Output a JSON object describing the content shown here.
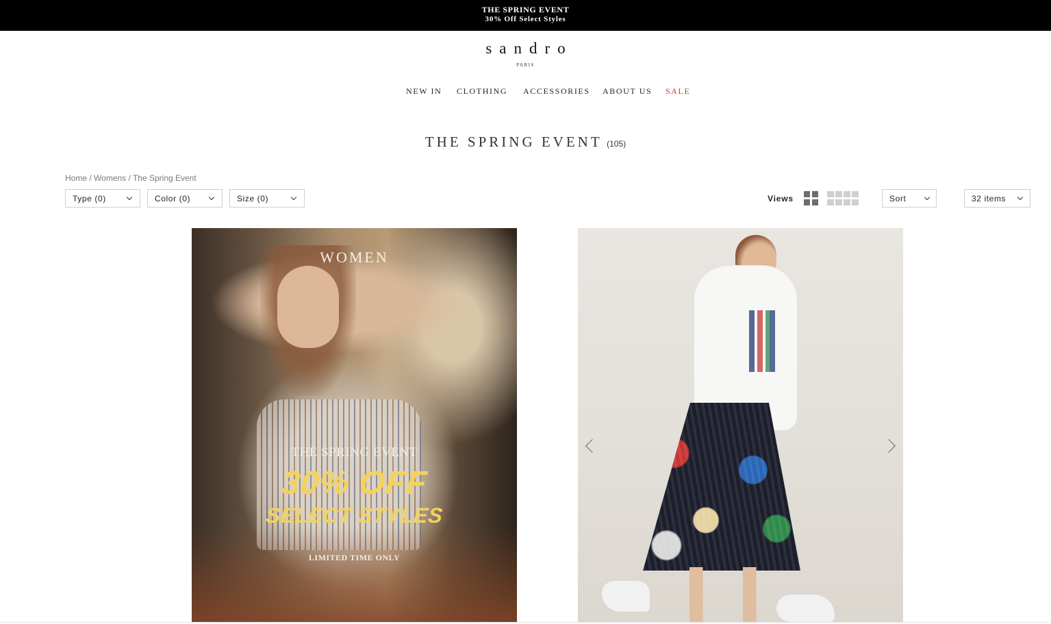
{
  "promo": {
    "title": "THE SPRING EVENT",
    "subtitle": "30% Off Select Styles"
  },
  "brand": {
    "logo": "sandro",
    "tagline": "PARIS"
  },
  "nav": {
    "items": [
      {
        "label": "NEW IN"
      },
      {
        "label": "CLOTHING"
      },
      {
        "label": "ACCESSORIES"
      },
      {
        "label": "ABOUT US"
      },
      {
        "label": "SALE"
      }
    ],
    "sale_color": "#c0392b"
  },
  "page": {
    "title": "THE SPRING EVENT",
    "count": "(105)"
  },
  "breadcrumb": {
    "home": "Home",
    "sep": " / ",
    "section": "Womens",
    "current": "The Spring Event"
  },
  "filters": {
    "type": "Type (0)",
    "color": "Color (0)",
    "size": "Size (0)"
  },
  "toolbar": {
    "views_label": "Views",
    "sort_label": "Sort",
    "items_label": "32 items"
  },
  "banner": {
    "women": "WOMEN",
    "event": "THE SPRING EVENT",
    "off": "30% OFF",
    "select": "SELECT STYLES",
    "limited": "LIMITED TIME ONLY",
    "accent_color": "#f3d35c"
  }
}
